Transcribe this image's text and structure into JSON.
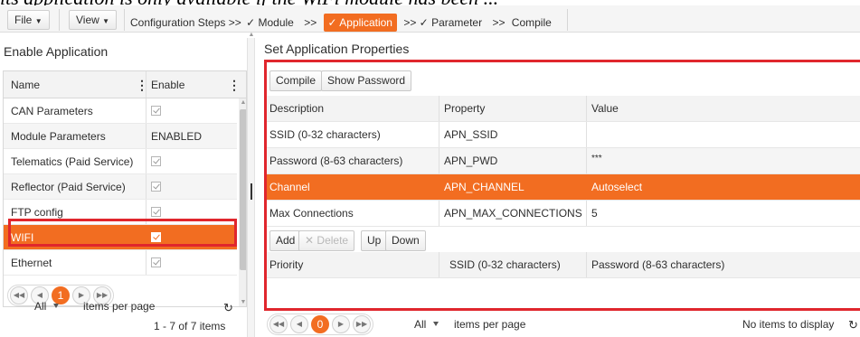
{
  "caption": "its application is only available if the WiFi module has been ...",
  "toolbar": {
    "file_label": "File",
    "view_label": "View",
    "steps": [
      {
        "label": "Configuration Steps >>",
        "active": false
      },
      {
        "label": "✓ Module",
        "active": false
      },
      {
        "label": ">>",
        "active": false
      },
      {
        "label": "✓ Application",
        "active": true
      },
      {
        "label": ">> ✓ Parameter",
        "active": false
      },
      {
        "label": ">>",
        "active": false
      },
      {
        "label": "Compile",
        "active": false
      }
    ]
  },
  "left": {
    "title": "Enable Application",
    "columns": {
      "name": "Name",
      "enable": "Enable"
    },
    "rows": [
      {
        "name": "CAN Parameters",
        "enable": "check"
      },
      {
        "name": "Module Parameters",
        "enable": "ENABLED"
      },
      {
        "name": "Telematics (Paid Service)",
        "enable": "check"
      },
      {
        "name": "Reflector (Paid Service)",
        "enable": "check"
      },
      {
        "name": "FTP config",
        "enable": "check"
      },
      {
        "name": "WIFI",
        "enable": "check",
        "selected": true
      },
      {
        "name": "Ethernet",
        "enable": "check"
      }
    ],
    "pager": {
      "current": "1",
      "page_size": "All",
      "page_size_label": "items per page",
      "summary": "1 - 7 of 7 items"
    }
  },
  "right": {
    "title": "Set Application Properties",
    "buttons": {
      "compile": "Compile",
      "show_password": "Show Password"
    },
    "columns": {
      "description": "Description",
      "property": "Property",
      "value": "Value"
    },
    "rows": [
      {
        "description": "SSID (0-32 characters)",
        "property": "APN_SSID",
        "value": ""
      },
      {
        "description": "Password (8-63 characters)",
        "property": "APN_PWD",
        "value": "***"
      },
      {
        "description": "Channel",
        "property": "APN_CHANNEL",
        "value": "Autoselect",
        "selected": true
      },
      {
        "description": "Max Connections",
        "property": "APN_MAX_CONNECTIONS",
        "value": "5"
      }
    ],
    "sub_buttons": {
      "add": "Add",
      "delete": "Delete",
      "up": "Up",
      "down": "Down"
    },
    "sub_columns": {
      "priority": "Priority",
      "ssid": "SSID (0-32 characters)",
      "password": "Password (8-63 characters)"
    },
    "pager": {
      "current": "0",
      "page_size": "All",
      "page_size_label": "items per page",
      "summary": "No items to display"
    }
  },
  "colors": {
    "accent": "#f26d21",
    "highlight_border": "#e0262d"
  }
}
